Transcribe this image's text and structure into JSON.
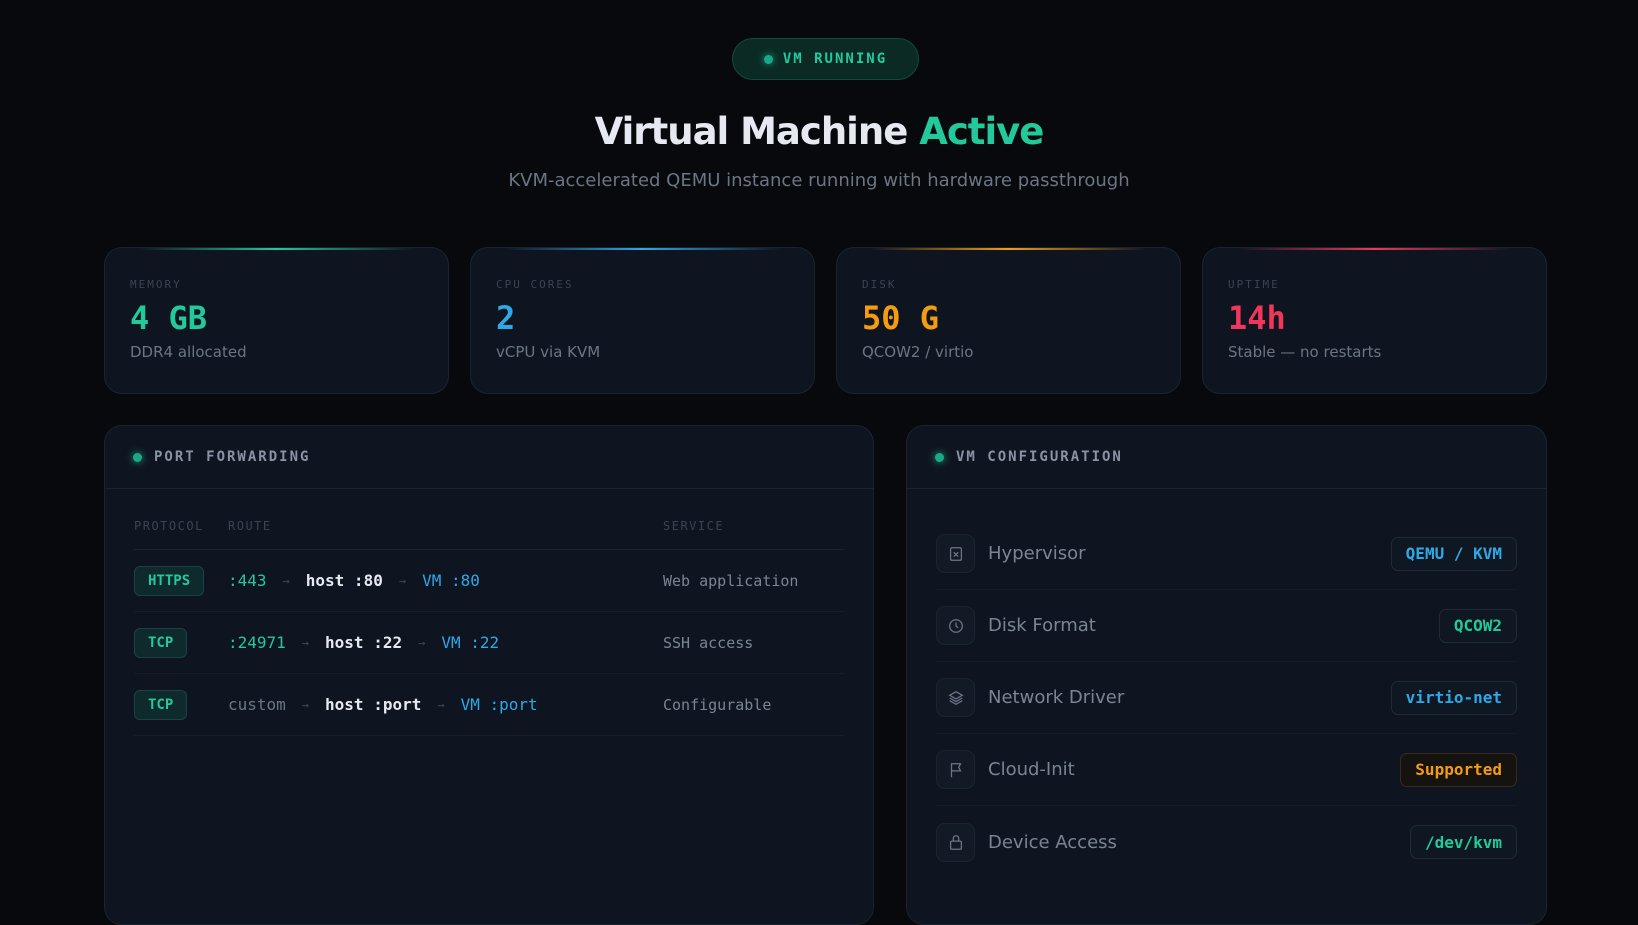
{
  "status_badge": "VM RUNNING",
  "title": {
    "main": "Virtual Machine",
    "accent": "Active"
  },
  "subtitle": "KVM-accelerated QEMU instance running with hardware passthrough",
  "colors": {
    "green": "#22c99b",
    "blue": "#2ea8e6",
    "orange": "#f39c12",
    "red": "#f0365a"
  },
  "stats": [
    {
      "label": "MEMORY",
      "value": "4 GB",
      "desc": "DDR4 allocated"
    },
    {
      "label": "CPU CORES",
      "value": "2",
      "desc": "vCPU via KVM"
    },
    {
      "label": "DISK",
      "value": "50 G",
      "desc": "QCOW2 / virtio"
    },
    {
      "label": "UPTIME",
      "value": "14h",
      "desc": "Stable — no restarts"
    }
  ],
  "ports": {
    "title": "PORT FORWARDING",
    "headers": [
      "PROTOCOL",
      "ROUTE",
      "SERVICE"
    ],
    "rows": [
      {
        "protocol": "HTTPS",
        "src": ":443",
        "host": "host :80",
        "vm": "VM :80",
        "service": "Web application"
      },
      {
        "protocol": "TCP",
        "src": ":24971",
        "host": "host :22",
        "vm": "VM :22",
        "service": "SSH access"
      },
      {
        "protocol": "TCP",
        "src": "custom",
        "host": "host :port",
        "vm": "VM :port",
        "service": "Configurable"
      }
    ]
  },
  "config": {
    "title": "VM CONFIGURATION",
    "items": [
      {
        "label": "Hypervisor",
        "value": "QEMU / KVM",
        "icon": "chip-icon"
      },
      {
        "label": "Disk Format",
        "value": "QCOW2",
        "icon": "clock-icon"
      },
      {
        "label": "Network Driver",
        "value": "virtio-net",
        "icon": "layers-icon"
      },
      {
        "label": "Cloud-Init",
        "value": "Supported",
        "icon": "flag-icon"
      },
      {
        "label": "Device Access",
        "value": "/dev/kvm",
        "icon": "lock-icon"
      }
    ]
  }
}
